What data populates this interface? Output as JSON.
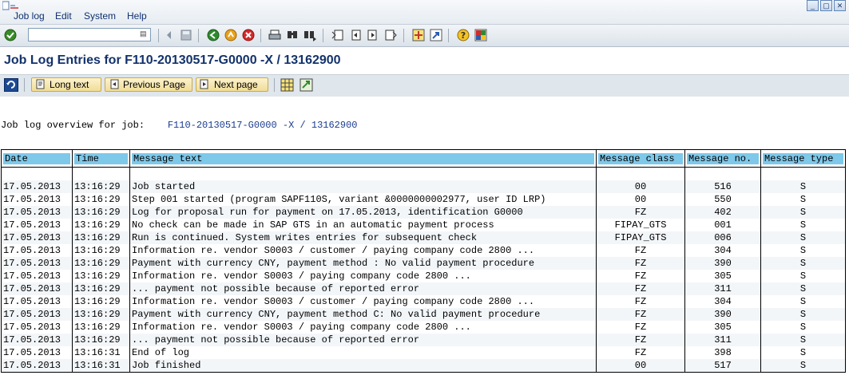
{
  "menubar": {
    "items": [
      "Job log",
      "Edit",
      "System",
      "Help"
    ]
  },
  "toolbar": {
    "command_field_value": "",
    "icons": [
      "enter-icon",
      "back-icon",
      "exit-icon",
      "cancel-icon",
      "print-icon",
      "find-icon",
      "find-next-icon",
      "first-page-icon",
      "previous-page-icon",
      "next-page-icon",
      "last-page-icon",
      "create-session-icon",
      "shortcut-icon",
      "help-icon",
      "customize-layout-icon"
    ]
  },
  "page": {
    "title": "Job Log Entries for F110-20130517-G0000 -X / 13162900"
  },
  "app_toolbar": {
    "long_text": "Long text",
    "previous_page": "Previous Page",
    "next_page": "Next page"
  },
  "overview": {
    "label": "Job log overview for job:",
    "job": "F110-20130517-G0000 -X / 13162900"
  },
  "table": {
    "headers": [
      "Date",
      "Time",
      "Message text",
      "Message class",
      "Message no.",
      "Message type"
    ],
    "rows": [
      [
        "17.05.2013",
        "13:16:29",
        "Job started",
        "00",
        "516",
        "S"
      ],
      [
        "17.05.2013",
        "13:16:29",
        "Step 001 started (program SAPF110S, variant &0000000002977, user ID LRP)",
        "00",
        "550",
        "S"
      ],
      [
        "17.05.2013",
        "13:16:29",
        "Log for proposal run for payment on 17.05.2013, identification G0000",
        "FZ",
        "402",
        "S"
      ],
      [
        "17.05.2013",
        "13:16:29",
        "No check can be made in SAP GTS in an automatic payment process",
        "FIPAY_GTS",
        "001",
        "S"
      ],
      [
        "17.05.2013",
        "13:16:29",
        "Run is continued. System writes entries for subsequent check",
        "FIPAY_GTS",
        "006",
        "S"
      ],
      [
        "17.05.2013",
        "13:16:29",
        "Information re. vendor S0003 / customer  / paying company code 2800 ...",
        "FZ",
        "304",
        "S"
      ],
      [
        "17.05.2013",
        "13:16:29",
        "Payment with currency CNY, payment method : No valid payment procedure",
        "FZ",
        "390",
        "S"
      ],
      [
        "17.05.2013",
        "13:16:29",
        "Information re. vendor S0003 / paying company code 2800 ...",
        "FZ",
        "305",
        "S"
      ],
      [
        "17.05.2013",
        "13:16:29",
        "... payment not possible because of reported error",
        "FZ",
        "311",
        "S"
      ],
      [
        "17.05.2013",
        "13:16:29",
        "Information re. vendor S0003 / customer  / paying company code 2800 ...",
        "FZ",
        "304",
        "S"
      ],
      [
        "17.05.2013",
        "13:16:29",
        "Payment with currency CNY, payment method C: No valid payment procedure",
        "FZ",
        "390",
        "S"
      ],
      [
        "17.05.2013",
        "13:16:29",
        "Information re. vendor S0003 / paying company code 2800 ...",
        "FZ",
        "305",
        "S"
      ],
      [
        "17.05.2013",
        "13:16:29",
        "... payment not possible because of reported error",
        "FZ",
        "311",
        "S"
      ],
      [
        "17.05.2013",
        "13:16:31",
        "End of log",
        "FZ",
        "398",
        "S"
      ],
      [
        "17.05.2013",
        "13:16:31",
        "Job finished",
        "00",
        "517",
        "S"
      ]
    ]
  },
  "colors": {
    "header_bg": "#7ec8ea",
    "title": "#13326b",
    "button_bg": "#f1dd96"
  }
}
